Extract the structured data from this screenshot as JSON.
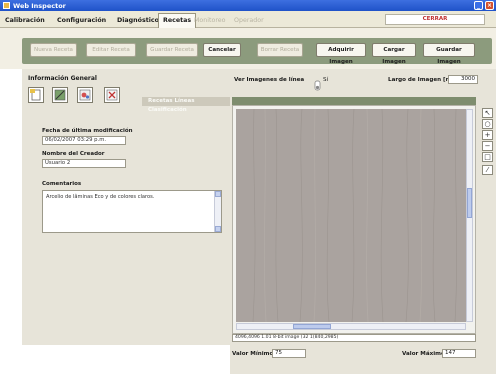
{
  "window": {
    "title": "Web Inspector",
    "minimize_label": "_",
    "close_label": "×"
  },
  "menu": {
    "tabs": [
      {
        "label": "Calibración",
        "state": "enabled"
      },
      {
        "label": "Configuración",
        "state": "enabled"
      },
      {
        "label": "Diagnóstico",
        "state": "enabled"
      },
      {
        "label": "Recetas",
        "state": "active"
      },
      {
        "label": "Monitoreo",
        "state": "disabled"
      },
      {
        "label": "Operador",
        "state": "disabled"
      }
    ],
    "close_button": "CERRAR"
  },
  "toolbar": {
    "nueva_receta": "Nueva Receta",
    "editar_receta": "Editar Receta",
    "guardar_receta": "Guardar Receta",
    "cancelar": "Cancelar",
    "borrar_receta": "Borrar Receta",
    "adquirir_imagen": "Adquirir Imagen",
    "cargar_imagen": "Cargar Imagen",
    "guardar_imagen": "Guardar Imagen"
  },
  "general": {
    "heading": "Información General",
    "link": "Recetas Líneas Clasificación",
    "fecha_label": "Fecha de última modificación",
    "fecha_value": "06/02/2007 03:29 p.m.",
    "creador_label": "Nombre del Creador",
    "creador_value": "Usuario 2",
    "comentarios_label": "Comentarios",
    "comentarios_value": "Arcelio de lâminas Eco y de colores claros."
  },
  "image_panel": {
    "ver_lineas_label": "Ver Imagenes de línea",
    "ver_lineas_value": "Sí",
    "largo_label": "Largo de Imagen [mm]",
    "largo_value": "3000",
    "status": "4096,4096 1.01 8-bit image (32    1(840,2985)",
    "valor_minimo_label": "Valor Mínimo:",
    "valor_minimo": "75",
    "valor_maximo_label": "Valor Máximo:",
    "valor_maximo": "147"
  },
  "colors": {
    "titlebar": "#1f52c8",
    "toolbar_green": "#8c9b7d",
    "panel": "#e7e4d9",
    "wood": "#a9a29e",
    "close_text": "#c03030"
  }
}
